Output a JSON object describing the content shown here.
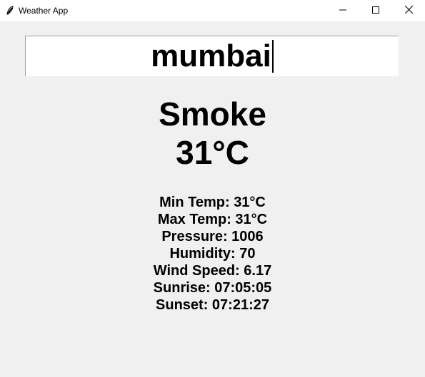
{
  "window": {
    "title": "Weather App",
    "icon": "feather-icon",
    "controls": {
      "minimize": "minimize-icon",
      "maximize": "maximize-icon",
      "close": "close-icon"
    }
  },
  "search": {
    "value": "mumbai"
  },
  "weather": {
    "condition": "Smoke",
    "temperature": "31°C",
    "details": {
      "min_temp": "Min Temp: 31°C",
      "max_temp": "Max Temp: 31°C",
      "pressure": "Pressure: 1006",
      "humidity": "Humidity: 70",
      "wind_speed": "Wind Speed: 6.17",
      "sunrise": "Sunrise: 07:05:05",
      "sunset": "Sunset: 07:21:27"
    }
  }
}
